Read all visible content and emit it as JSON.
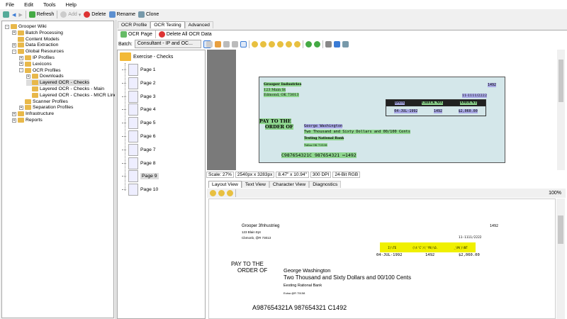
{
  "menu": [
    "File",
    "Edit",
    "Tools",
    "Help"
  ],
  "toolbar": {
    "refresh": "Refresh",
    "add": "Add",
    "delete": "Delete",
    "rename": "Rename",
    "clone": "Clone"
  },
  "tree": [
    {
      "label": "Grooper Wiki",
      "level": 0,
      "exp": "-"
    },
    {
      "label": "Batch Processing",
      "level": 1,
      "exp": "+"
    },
    {
      "label": "Content Models",
      "level": 1,
      "exp": ""
    },
    {
      "label": "Data Extraction",
      "level": 1,
      "exp": "+"
    },
    {
      "label": "Global Resources",
      "level": 1,
      "exp": "-"
    },
    {
      "label": "IP Profiles",
      "level": 2,
      "exp": "+"
    },
    {
      "label": "Lexicons",
      "level": 2,
      "exp": "+"
    },
    {
      "label": "OCR Profiles",
      "level": 2,
      "exp": "-"
    },
    {
      "label": "Downloads",
      "level": 3,
      "exp": "+"
    },
    {
      "label": "Layered OCR - Checks",
      "level": 3,
      "exp": "",
      "selected": true
    },
    {
      "label": "Layered OCR - Checks - Main",
      "level": 3,
      "exp": ""
    },
    {
      "label": "Layered OCR - Checks - MICR Line",
      "level": 3,
      "exp": ""
    },
    {
      "label": "Scanner Profiles",
      "level": 2,
      "exp": ""
    },
    {
      "label": "Separation Profiles",
      "level": 2,
      "exp": "+"
    },
    {
      "label": "Infrastructure",
      "level": 1,
      "exp": "+"
    },
    {
      "label": "Reports",
      "level": 1,
      "exp": "+"
    }
  ],
  "tabs": [
    "OCR Profile",
    "OCR Testing",
    "Advanced"
  ],
  "ocr_toolbar": {
    "ocr_page": "OCR Page",
    "delete_all": "Delete All OCR Data"
  },
  "batch": {
    "label": "Batch:",
    "value": "Consultant - IP and OC..."
  },
  "batch_tree": {
    "folder": "Exercise - Checks",
    "pages": [
      "Page 1",
      "Page 2",
      "Page 3",
      "Page 4",
      "Page 5",
      "Page 6",
      "Page 7",
      "Page 8",
      "Page 9",
      "Page 10"
    ],
    "selected": "Page 9"
  },
  "status": [
    "Scale: 27%",
    "2540px x 3283px",
    "8.47\" x 10.94\"",
    "300 DPI",
    "24-Bit RGB"
  ],
  "view_tabs": [
    "Layout View",
    "Text View",
    "Character View",
    "Diagnostics"
  ],
  "zoom_level": "100%",
  "check_image": {
    "company": "Grooper Industries",
    "addr1": "123 Main St",
    "addr2": "Edmond, OK 73013",
    "number": "1492",
    "routing": "11-1111/2222",
    "headers": [
      "DATE",
      "CHECK NO.",
      "AMOUNT"
    ],
    "values": [
      "04-JUL-1992",
      "1492",
      "$2,060.00"
    ],
    "pay1": "PAY TO THE",
    "pay2": "ORDER OF",
    "payee": "George Washington",
    "amount_words": "Two Thousand and Sixty Dollars and 00/100 Cents",
    "bank": "Testing National Bank",
    "bank_addr": "Tulsa OK 73138",
    "micr": "C987654321C 987654321 ⑅1492"
  },
  "ocr_text": {
    "company": "Grooper 3fnhustrieg",
    "addr1": "123 Blain Ept",
    "addr2": "Cbmonb, @R 73013",
    "number": "1492",
    "routing": "11-1111/2222",
    "headers": [
      "I)\\TE",
      "(\\t'C'/('fK)\\O.",
      "_\\M()\\NT"
    ],
    "values": [
      "04-JUL-1992",
      "1492",
      "$2,060.00"
    ],
    "pay1": "PAY TO THE",
    "pay2": "ORDER OF",
    "payee": "George Washington",
    "amount_words": "Two Thousand and Sixty Dollars and 00/100 Cents",
    "bank": "Eesting Rational Bank",
    "bank_addr": "Euisa @R 75158",
    "micr": "A987654321A 987654321 C1492"
  }
}
